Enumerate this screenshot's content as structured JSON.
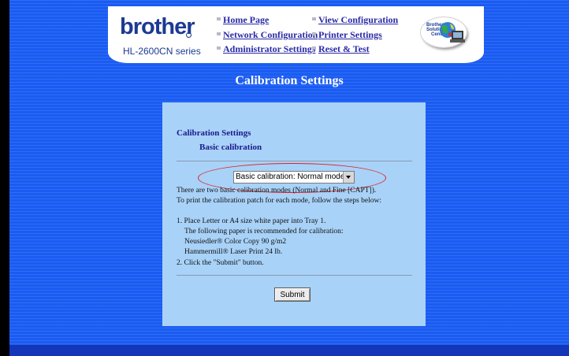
{
  "header": {
    "logo": "brother",
    "model": "HL-2600CN series",
    "nav": {
      "home": "Home Page",
      "network_config": "Network Configuration",
      "admin_settings": "Administrator Settings",
      "view_config": "View Configuration",
      "printer_settings": "Printer Settings",
      "reset_test": "Reset & Test"
    },
    "badge": [
      "Brother",
      "Solutions",
      "Center"
    ]
  },
  "page_title": "Calibration Settings",
  "panel": {
    "section_title": "Calibration Settings",
    "section_subtitle": "Basic calibration",
    "select_value": "Basic calibration: Normal mode.",
    "intro_1": "There are two basic calibration modes (Normal and Fine [CAPT]).",
    "intro_2": "To print the calibration patch for each mode, follow the steps below:",
    "step_1": "1. Place Letter or A4 size white paper into Tray 1.",
    "step_1_detail": "The following paper is recommended for calibration:",
    "paper_1": "Neusiedler® Color Copy  90 g/m2",
    "paper_2": "Hammermill® Laser Print 24 lb.",
    "step_2": "2. Click the \"Submit\" button.",
    "submit_label": "Submit"
  },
  "colors": {
    "background": "#1a5cf2",
    "panel": "#a8d2f8",
    "heading": "#1a1a8a",
    "link": "#2a2aa8",
    "highlight_oval": "#e02020"
  }
}
